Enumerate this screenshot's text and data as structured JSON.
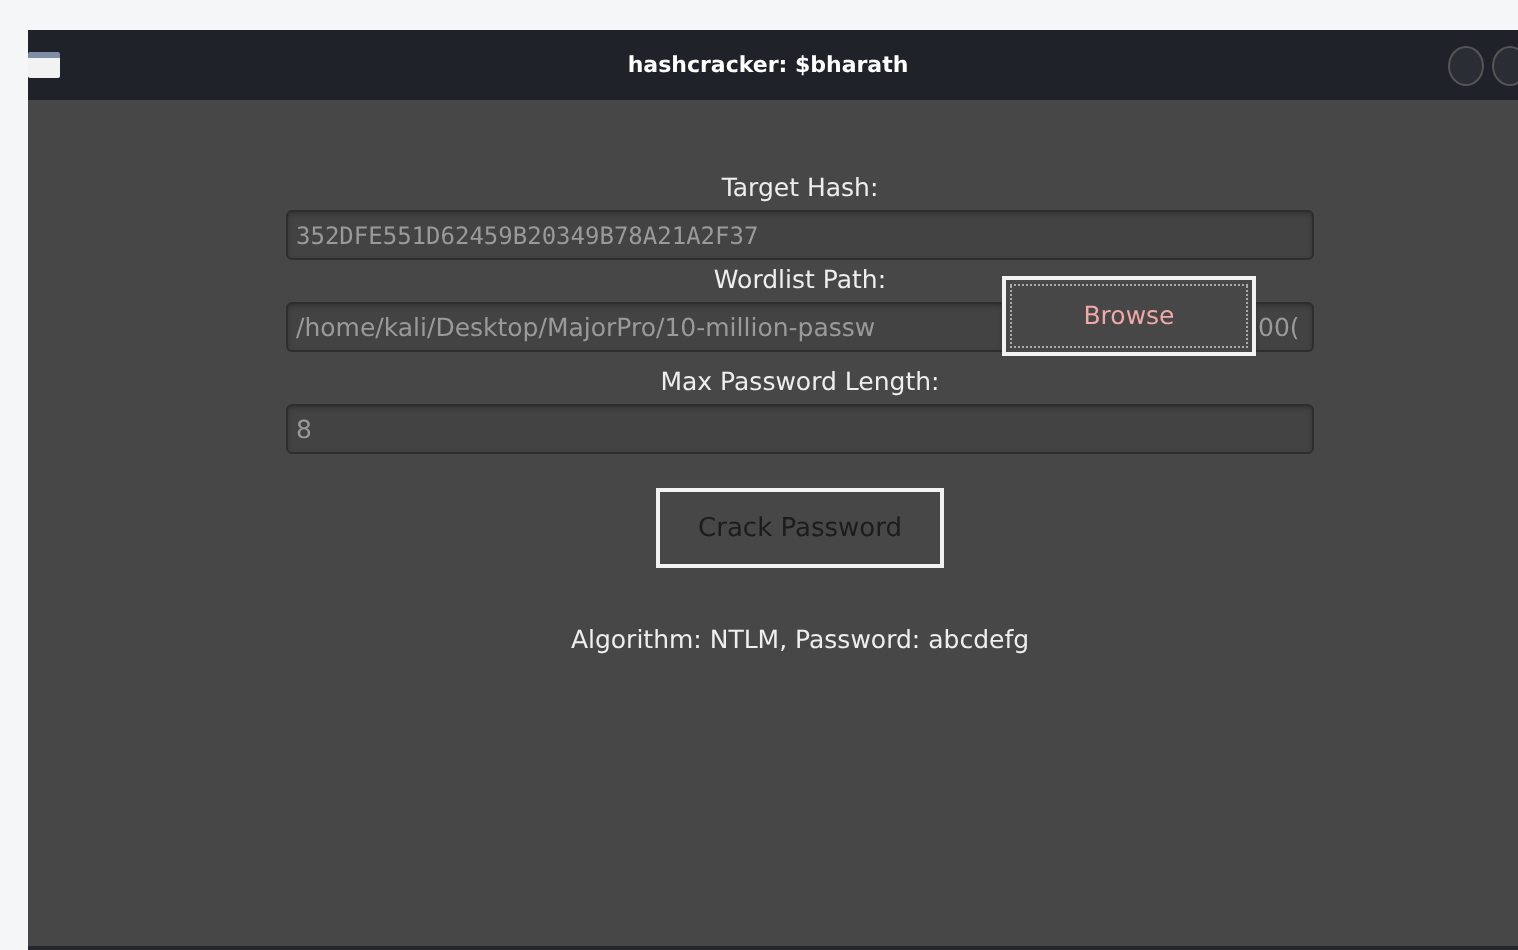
{
  "window": {
    "title": "hashcracker: $bharath"
  },
  "target_hash": {
    "label": "Target Hash:",
    "value": "352DFE551D62459B20349B78A21A2F37"
  },
  "wordlist": {
    "label": "Wordlist Path:",
    "value": "/home/kali/Desktop/MajorPro/10-million-passw",
    "value_tail": "00(",
    "browse_button": "Browse"
  },
  "max_length": {
    "label": "Max Password Length:",
    "value": "8"
  },
  "crack_button": "Crack Password",
  "result": "Algorithm: NTLM, Password: abcdefg"
}
